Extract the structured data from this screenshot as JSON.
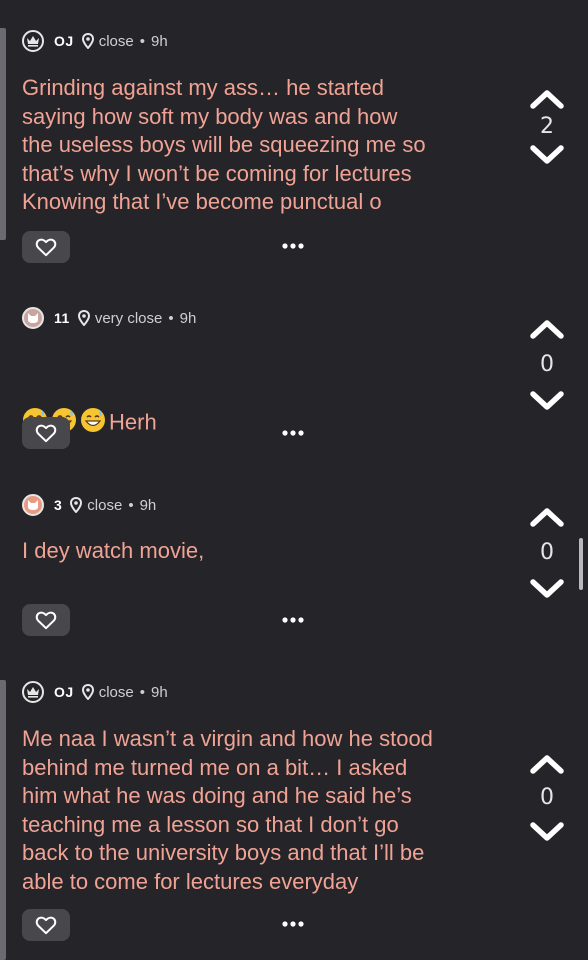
{
  "posts": [
    {
      "author": "OJ",
      "avatar": "crown-icon",
      "distance": "close",
      "separator": "•",
      "time": "9h",
      "text": "Grinding against my ass… he started\nsaying how soft my body was and how\nthe useless boys will be squeezing me so\nthat’s why I won’t be coming for lectures\nKnowing that I’ve become punctual o",
      "votes": "2"
    },
    {
      "author": "11",
      "avatar": "cat-icon",
      "distance": "very close",
      "separator": "•",
      "time": "9h",
      "emojis": [
        "grinning-sweat-emoji",
        "grinning-sweat-emoji",
        "grinning-sweat-emoji"
      ],
      "text": "Herh",
      "votes": "0"
    },
    {
      "author": "3",
      "avatar": "cat-icon",
      "distance": "close",
      "separator": "•",
      "time": "9h",
      "text": "I dey watch movie,",
      "votes": "0"
    },
    {
      "author": "OJ",
      "avatar": "crown-icon",
      "distance": "close",
      "separator": "•",
      "time": "9h",
      "text": "Me naa I wasn’t a virgin and how he stood\nbehind me turned me on a bit… I asked\nhim what he was doing and he said he’s\nteaching me a lesson so that I don’t go\nback to the university boys and that I’ll be\nable to come for lectures everyday",
      "votes": "0"
    }
  ],
  "colors": {
    "background": "#252429",
    "text": "#f0a394",
    "meta": "#cfcfd3",
    "like_button": "#48474c",
    "avatar_cat_1": "#c9a5a0",
    "avatar_cat_2": "#e89a82"
  },
  "icons": {
    "like": "heart-outline-icon",
    "more": "more-dots-icon",
    "upvote": "chevron-up-icon",
    "downvote": "chevron-down-icon",
    "location": "location-pin-icon"
  }
}
